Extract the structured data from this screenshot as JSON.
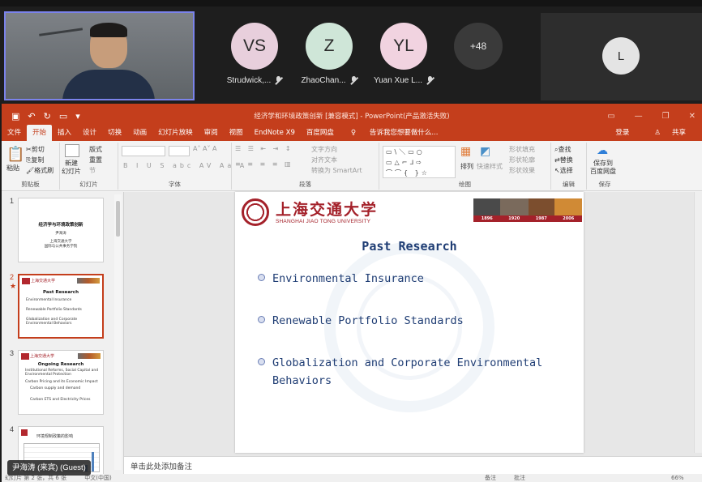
{
  "meeting": {
    "participants": [
      {
        "initials": "VS",
        "name": "Strudwick,...",
        "color": "#e8cfdc"
      },
      {
        "initials": "Z",
        "name": "ZhaoChan...",
        "color": "#cfe6d8"
      },
      {
        "initials": "YL",
        "name": "Yuan Xue L...",
        "color": "#f1d3e0"
      }
    ],
    "more_count": "+48",
    "side_tile_initial": "L",
    "guest_label": "尹海涛 (来宾) (Guest)"
  },
  "ppt": {
    "window_title": "经济学和环境政策创新 [兼容模式] - PowerPoint(产品激活失败)",
    "tabs": [
      "文件",
      "开始",
      "插入",
      "设计",
      "切换",
      "动画",
      "幻灯片放映",
      "审阅",
      "视图",
      "EndNote X9",
      "百度网盘"
    ],
    "active_tab": "开始",
    "tell_me": "告诉我您想要做什么...",
    "login": "登录",
    "share": "共享",
    "ribbon": {
      "paste": "粘贴",
      "cut": "剪切",
      "copy": "复制",
      "format_painter": "格式刷",
      "clipboard_group": "剪贴板",
      "new_slide": "新建",
      "new_slide2": "幻灯片",
      "layout": "版式",
      "reset": "重置",
      "section": "节",
      "slides_group": "幻灯片",
      "font_group": "字体",
      "text_direction": "文字方向",
      "align_text": "对齐文本",
      "smartart": "转换为 SmartArt",
      "paragraph_group": "段落",
      "arrange": "排列",
      "quick_styles": "快速样式",
      "shape_fill": "形状填充",
      "shape_outline": "形状轮廓",
      "shape_effects": "形状效果",
      "drawing_group": "绘图",
      "find": "查找",
      "replace": "替换",
      "select": "选择",
      "editing_group": "编辑",
      "save_baidu": "保存到",
      "save_baidu2": "百度网盘",
      "save_group": "保存"
    },
    "thumbnails": [
      {
        "num": "1",
        "title": "经济学与环境政策创新",
        "lines": [
          "尹海涛",
          "上海交通大学",
          "国际与公共事务学院"
        ]
      },
      {
        "num": "2",
        "title": "Past Research",
        "lines": [
          "Environmental Insurance",
          "Renewable Portfolio Standards",
          "Globalization and Corporate Environmental Behaviors"
        ]
      },
      {
        "num": "3",
        "title": "Ongoing Research",
        "lines": [
          "Institutional Reforms, Social Capital and Environmental Protection",
          "Carbon Pricing and its Economic Impact",
          "Carbon supply and demand",
          "Carbon ETS and Electricity Prices"
        ]
      },
      {
        "num": "4",
        "title": "环境规制政策的影响",
        "lines": []
      }
    ],
    "slide": {
      "university_cn": "上海交通大学",
      "university_en": "SHANGHAI JIAO TONG UNIVERSITY",
      "years": [
        "1896",
        "1920",
        "1987",
        "2006"
      ],
      "title": "Past Research",
      "bullets": [
        "Environmental Insurance",
        "Renewable Portfolio Standards",
        "Globalization and Corporate Environmental Behaviors"
      ]
    },
    "notes_placeholder": "单击此处添加备注",
    "status": {
      "slide": "幻灯片 第 2 张，共 6 张",
      "lang": "中文(中国)",
      "notes": "备注",
      "comments": "批注",
      "zoom": "66%"
    }
  }
}
